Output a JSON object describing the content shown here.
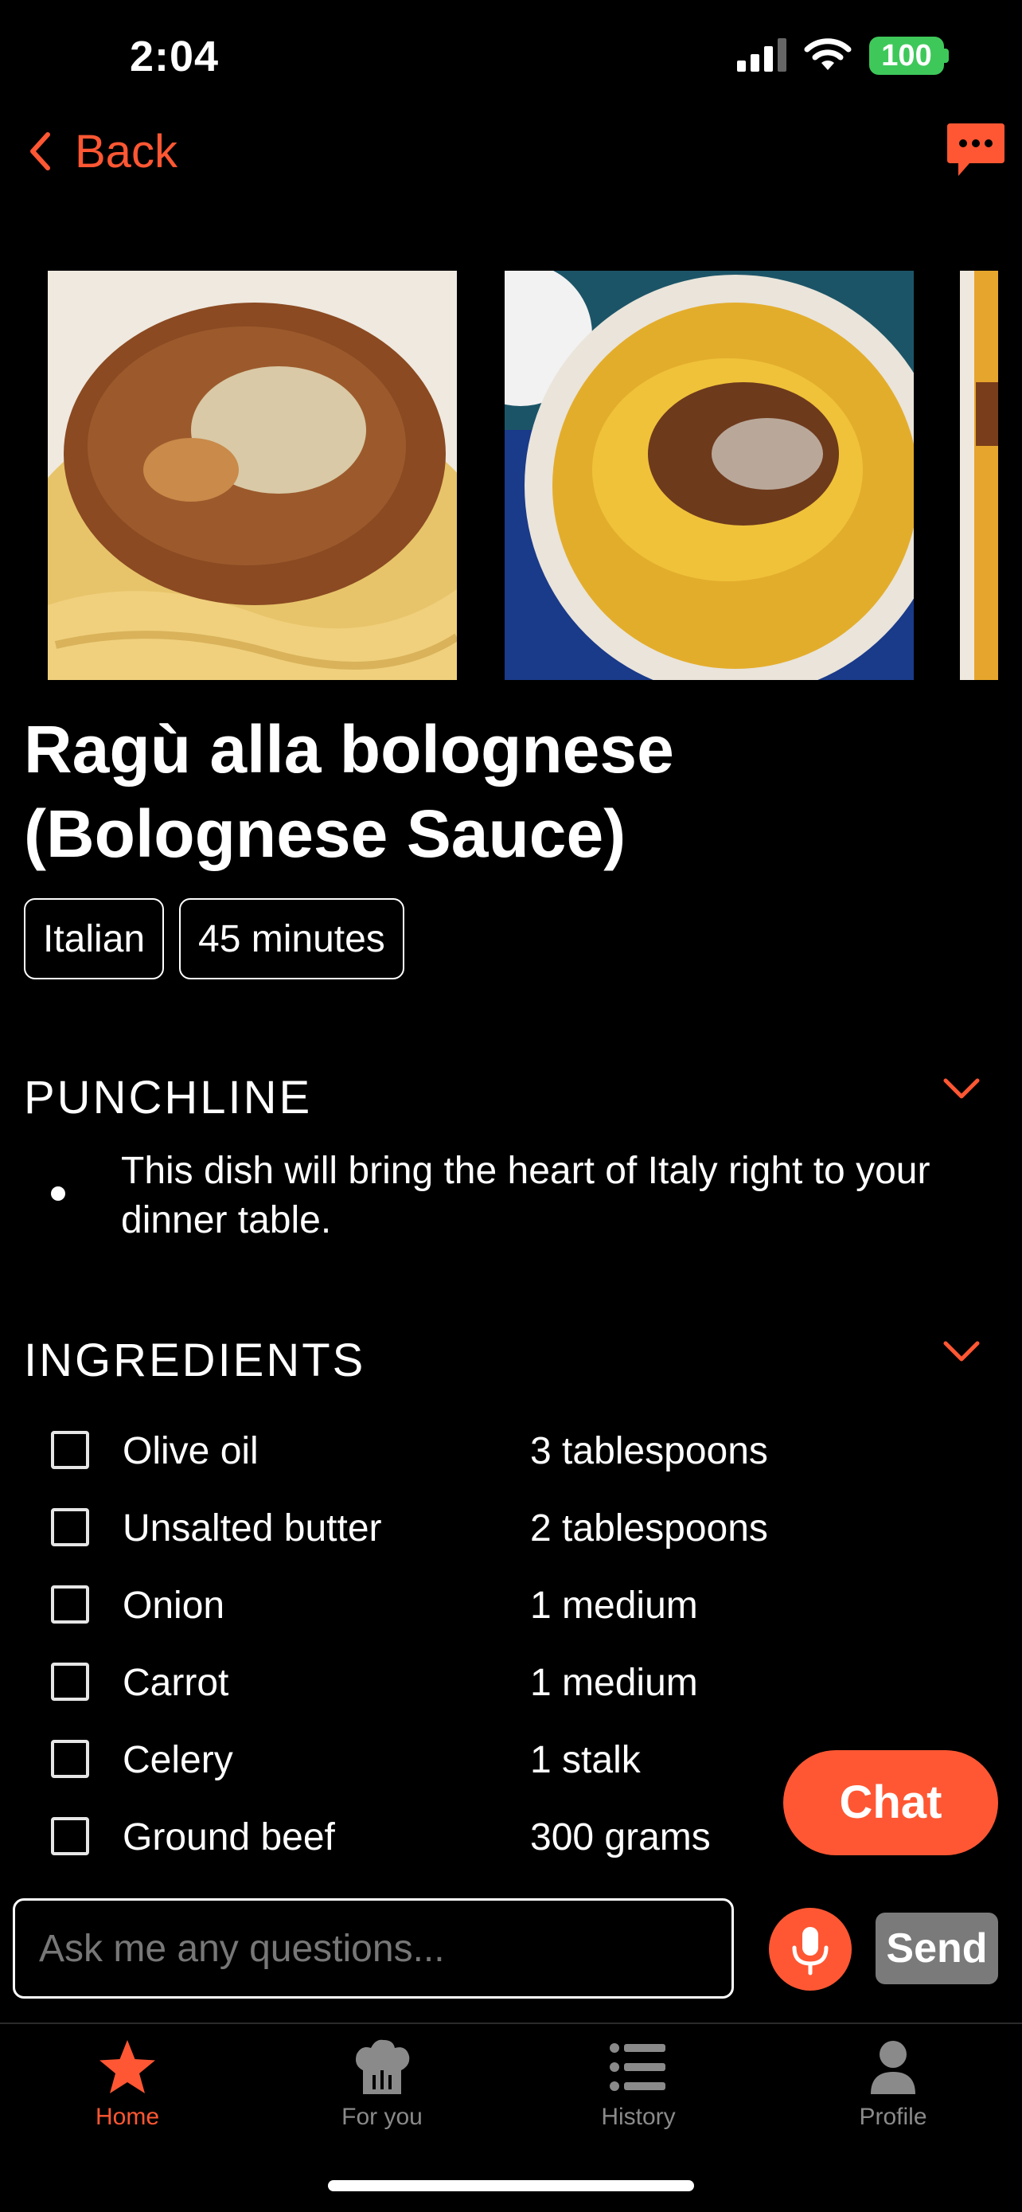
{
  "status_bar": {
    "time": "2:04",
    "battery": "100"
  },
  "nav": {
    "back_label": "Back"
  },
  "recipe": {
    "title": "Ragù alla bolognese (Bolognese Sauce)",
    "tags": [
      "Italian",
      "45 minutes"
    ],
    "punchline_heading": "PUNCHLINE",
    "punchline": "This dish will bring the heart of Italy right to your dinner table.",
    "ingredients_heading": "INGREDIENTS",
    "ingredients": [
      {
        "name": "Olive oil",
        "qty": "3 tablespoons"
      },
      {
        "name": "Unsalted butter",
        "qty": "2 tablespoons"
      },
      {
        "name": "Onion",
        "qty": "1 medium"
      },
      {
        "name": "Carrot",
        "qty": "1 medium"
      },
      {
        "name": "Celery",
        "qty": "1 stalk"
      },
      {
        "name": "Ground beef",
        "qty": "300 grams"
      }
    ]
  },
  "chat": {
    "fab_label": "Chat",
    "placeholder": "Ask me any questions...",
    "send_label": "Send"
  },
  "tabs": [
    {
      "label": "Home",
      "icon": "star-icon",
      "active": true
    },
    {
      "label": "For you",
      "icon": "chef-hat-icon",
      "active": false
    },
    {
      "label": "History",
      "icon": "list-icon",
      "active": false
    },
    {
      "label": "Profile",
      "icon": "person-icon",
      "active": false
    }
  ],
  "colors": {
    "accent": "#ff5733",
    "battery": "#3ec85a",
    "inactive_tab": "#8a8a8a",
    "send_bg": "#7a7a7a"
  }
}
